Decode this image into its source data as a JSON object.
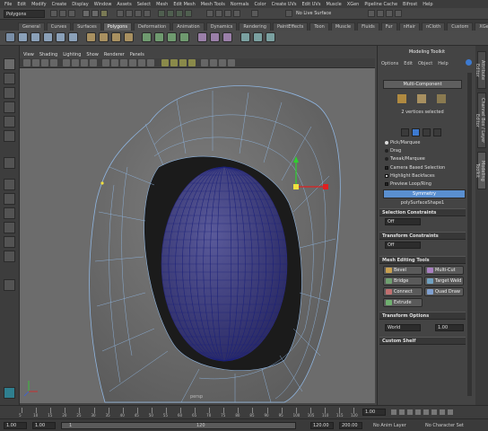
{
  "menubar": {
    "items": [
      "File",
      "Edit",
      "Modify",
      "Create",
      "Display",
      "Window",
      "Assets",
      "Select",
      "Mesh",
      "Edit Mesh",
      "Mesh Tools",
      "Normals",
      "Color",
      "Create UVs",
      "Edit UVs",
      "Muscle",
      "XGen",
      "Pipeline Cache",
      "Bifrost",
      "Help"
    ]
  },
  "statusline": {
    "mode": "Polygons",
    "live_surface": "No Live Surface"
  },
  "shelf_tabs": [
    "General",
    "Curves",
    "Surfaces",
    "Polygons",
    "Deformation",
    "Animation",
    "Dynamics",
    "Rendering",
    "PaintEffects",
    "Toon",
    "Muscle",
    "Fluids",
    "Fur",
    "nHair",
    "nCloth",
    "Custom",
    "XGen"
  ],
  "active_shelf_tab": "Polygons",
  "panel_menu": [
    "View",
    "Shading",
    "Lighting",
    "Show",
    "Renderer",
    "Panels"
  ],
  "viewport": {
    "camera_label": "persp"
  },
  "modeling_toolkit": {
    "title": "Modeling Toolkit",
    "menu": [
      "Options",
      "Edit",
      "Object",
      "Help"
    ],
    "multi_component": "Multi-Component",
    "selection_status": "2 vertices selected",
    "pick_marquee": "Pick/Marquee",
    "drag": "Drag",
    "tweak_marquee": "Tweak/Marquee",
    "camera_based_selection": "Camera Based Selection",
    "highlight_backfaces": "Highlight Backfaces",
    "preview_loop_ring": "Preview Loop/Ring",
    "symmetry": "Symmetry",
    "object_name": "polySurfaceShape1",
    "selection_constraints": "Selection Constraints",
    "selection_constraints_value": "Off",
    "transform_constraints": "Transform Constraints",
    "transform_constraints_value": "Off",
    "mesh_editing_tools": "Mesh Editing Tools",
    "tools": [
      "Bevel",
      "Multi-Cut",
      "Bridge",
      "Target Weld",
      "Connect",
      "Quad Draw",
      "Extrude"
    ],
    "transform_options": "Transform Options",
    "space": "World",
    "space_value": "1.00",
    "custom_shelf": "Custom Shelf"
  },
  "side_tabs": [
    "Attribute Editor",
    "Channel Box / Layer Editor",
    "Modeling Toolkit"
  ],
  "timeline": {
    "ticks": [
      "5",
      "10",
      "15",
      "20",
      "25",
      "30",
      "35",
      "40",
      "45",
      "50",
      "55",
      "60",
      "65",
      "70",
      "75",
      "80",
      "85",
      "90",
      "95",
      "100",
      "105",
      "110",
      "115",
      "120"
    ],
    "current_frame": "1.00"
  },
  "range": {
    "start": "1.00",
    "start_inner": "1.00",
    "inner_box": "1",
    "range_end_label": "120",
    "end_inner": "120.00",
    "end": "200.00",
    "anim_layer": "No Anim Layer",
    "char_set": "No Character Set"
  },
  "colors": {
    "accent": "#5a8fd0",
    "mesh_wire": "#7fb0e0",
    "inner_wire": "#1a1f7a"
  }
}
